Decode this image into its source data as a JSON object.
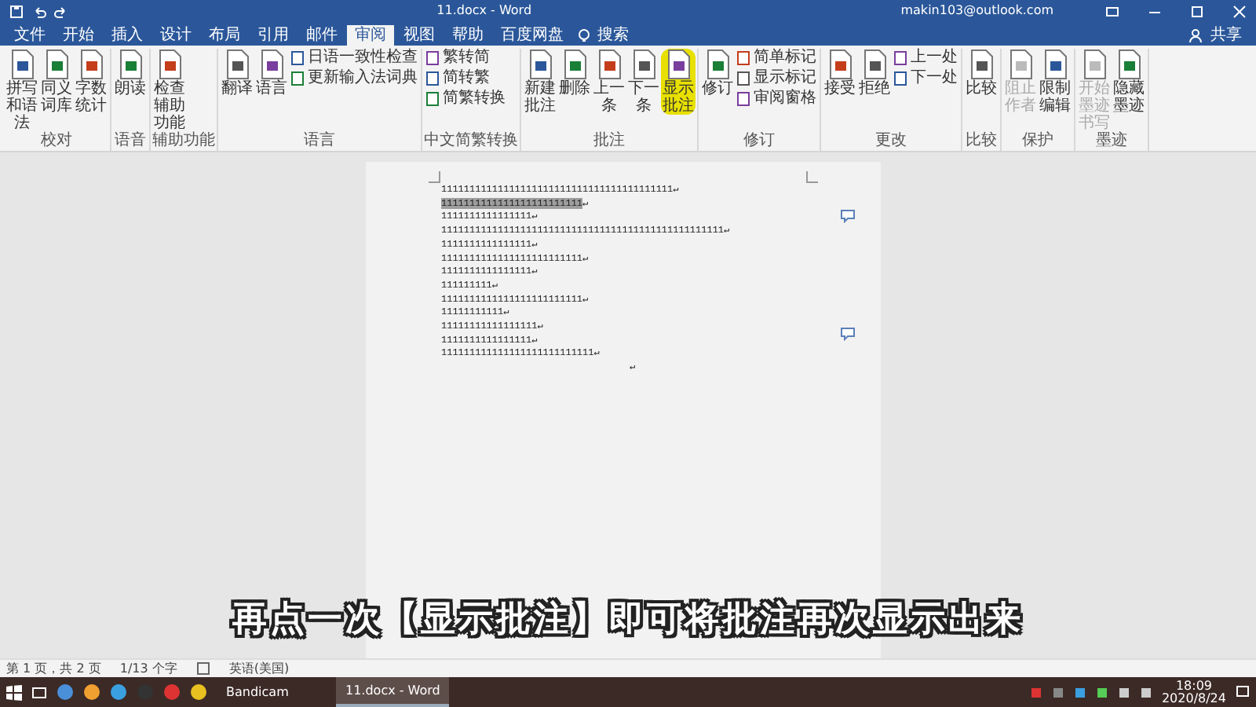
{
  "window": {
    "title": "11.docx - Word",
    "account": "makin103@outlook.com",
    "share": "共享"
  },
  "tabs": [
    {
      "label": "文件",
      "selected": false
    },
    {
      "label": "开始",
      "selected": false
    },
    {
      "label": "插入",
      "selected": false
    },
    {
      "label": "设计",
      "selected": false
    },
    {
      "label": "布局",
      "selected": false
    },
    {
      "label": "引用",
      "selected": false
    },
    {
      "label": "邮件",
      "selected": false
    },
    {
      "label": "审阅",
      "selected": true
    },
    {
      "label": "视图",
      "selected": false
    },
    {
      "label": "帮助",
      "selected": false
    },
    {
      "label": "百度网盘",
      "selected": false
    }
  ],
  "tell_me": "搜索",
  "ribbon": {
    "groups": [
      {
        "label": "校对",
        "buttons": [
          {
            "label": "拼写和语法",
            "kind": "large",
            "disabled": false,
            "highlighted": false
          },
          {
            "label": "同义词库",
            "kind": "large",
            "disabled": false,
            "highlighted": false
          },
          {
            "label": "字数统计",
            "kind": "large",
            "disabled": false,
            "highlighted": false
          }
        ]
      },
      {
        "label": "语音",
        "buttons": [
          {
            "label": "朗读",
            "kind": "large",
            "disabled": false,
            "highlighted": false
          }
        ]
      },
      {
        "label": "辅助功能",
        "buttons": [
          {
            "label": "检查辅助功能",
            "kind": "large",
            "disabled": false,
            "highlighted": false
          }
        ]
      },
      {
        "label": "语言",
        "buttons": [
          {
            "label": "翻译",
            "kind": "large",
            "disabled": false,
            "highlighted": false
          },
          {
            "label": "语言",
            "kind": "large",
            "disabled": false,
            "highlighted": false
          },
          {
            "label": "日语一致性检查",
            "kind": "small",
            "disabled": false,
            "highlighted": false
          },
          {
            "label": "更新输入法词典",
            "kind": "small",
            "disabled": false,
            "highlighted": false
          }
        ]
      },
      {
        "label": "中文简繁转换",
        "buttons": [
          {
            "label": "繁转简",
            "kind": "small",
            "disabled": false,
            "highlighted": false
          },
          {
            "label": "简转繁",
            "kind": "small",
            "disabled": false,
            "highlighted": false
          },
          {
            "label": "简繁转换",
            "kind": "small",
            "disabled": false,
            "highlighted": false
          }
        ]
      },
      {
        "label": "批注",
        "buttons": [
          {
            "label": "新建批注",
            "kind": "large",
            "disabled": false,
            "highlighted": false
          },
          {
            "label": "删除",
            "kind": "large",
            "disabled": false,
            "highlighted": false
          },
          {
            "label": "上一条",
            "kind": "large",
            "disabled": false,
            "highlighted": false
          },
          {
            "label": "下一条",
            "kind": "large",
            "disabled": false,
            "highlighted": false
          },
          {
            "label": "显示批注",
            "kind": "large",
            "disabled": false,
            "highlighted": true
          }
        ]
      },
      {
        "label": "修订",
        "buttons": [
          {
            "label": "修订",
            "kind": "large",
            "disabled": false,
            "highlighted": false
          },
          {
            "label": "简单标记",
            "kind": "small",
            "disabled": false,
            "highlighted": false
          },
          {
            "label": "显示标记",
            "kind": "small",
            "disabled": false,
            "highlighted": false
          },
          {
            "label": "审阅窗格",
            "kind": "small",
            "disabled": false,
            "highlighted": false
          }
        ]
      },
      {
        "label": "更改",
        "buttons": [
          {
            "label": "接受",
            "kind": "large",
            "disabled": false,
            "highlighted": false
          },
          {
            "label": "拒绝",
            "kind": "large",
            "disabled": false,
            "highlighted": false
          },
          {
            "label": "上一处",
            "kind": "small",
            "disabled": false,
            "highlighted": false
          },
          {
            "label": "下一处",
            "kind": "small",
            "disabled": false,
            "highlighted": false
          }
        ]
      },
      {
        "label": "比较",
        "buttons": [
          {
            "label": "比较",
            "kind": "large",
            "disabled": false,
            "highlighted": false
          }
        ]
      },
      {
        "label": "保护",
        "buttons": [
          {
            "label": "阻止作者",
            "kind": "large",
            "disabled": true,
            "highlighted": false
          },
          {
            "label": "限制编辑",
            "kind": "large",
            "disabled": false,
            "highlighted": false
          }
        ]
      },
      {
        "label": "墨迹",
        "buttons": [
          {
            "label": "开始墨迹书写",
            "kind": "large",
            "disabled": true,
            "highlighted": false
          },
          {
            "label": "隐藏墨迹",
            "kind": "large",
            "disabled": false,
            "highlighted": false
          }
        ]
      }
    ]
  },
  "document": {
    "lines": [
      {
        "text": "11111111111111111111111111111111111111111↵",
        "selected": false
      },
      {
        "text": "1111111111111111111111111",
        "selected": true,
        "mark": "↵"
      },
      {
        "text": "1111111111111111↵",
        "selected": false
      },
      {
        "text": "11111111111111111111111111111111111111111111111111↵",
        "selected": false
      },
      {
        "text": "1111111111111111↵",
        "selected": false
      },
      {
        "text": "1111111111111111111111111↵",
        "selected": false
      },
      {
        "text": "1111111111111111↵",
        "selected": false
      },
      {
        "text": "111111111↵",
        "selected": false
      },
      {
        "text": "1111111111111111111111111↵",
        "selected": false
      },
      {
        "text": "11111111111↵",
        "selected": false
      },
      {
        "text": "11111111111111111↵",
        "selected": false
      },
      {
        "text": "1111111111111111↵",
        "selected": false
      },
      {
        "text": "111111111111111111111111111↵",
        "selected": false
      }
    ],
    "end_mark": "↵"
  },
  "caption": "再点一次【显示批注】即可将批注再次显示出来",
  "status_bar": {
    "page": "第 1 页，共 2 页",
    "words": "1/13 个字",
    "language": "英语(美国)"
  },
  "taskbar": {
    "apps": [
      {
        "label": "Bandicam",
        "active": false
      },
      {
        "label": "11.docx - Word",
        "active": true
      }
    ],
    "time": "18:09",
    "date": "2020/8/24"
  }
}
